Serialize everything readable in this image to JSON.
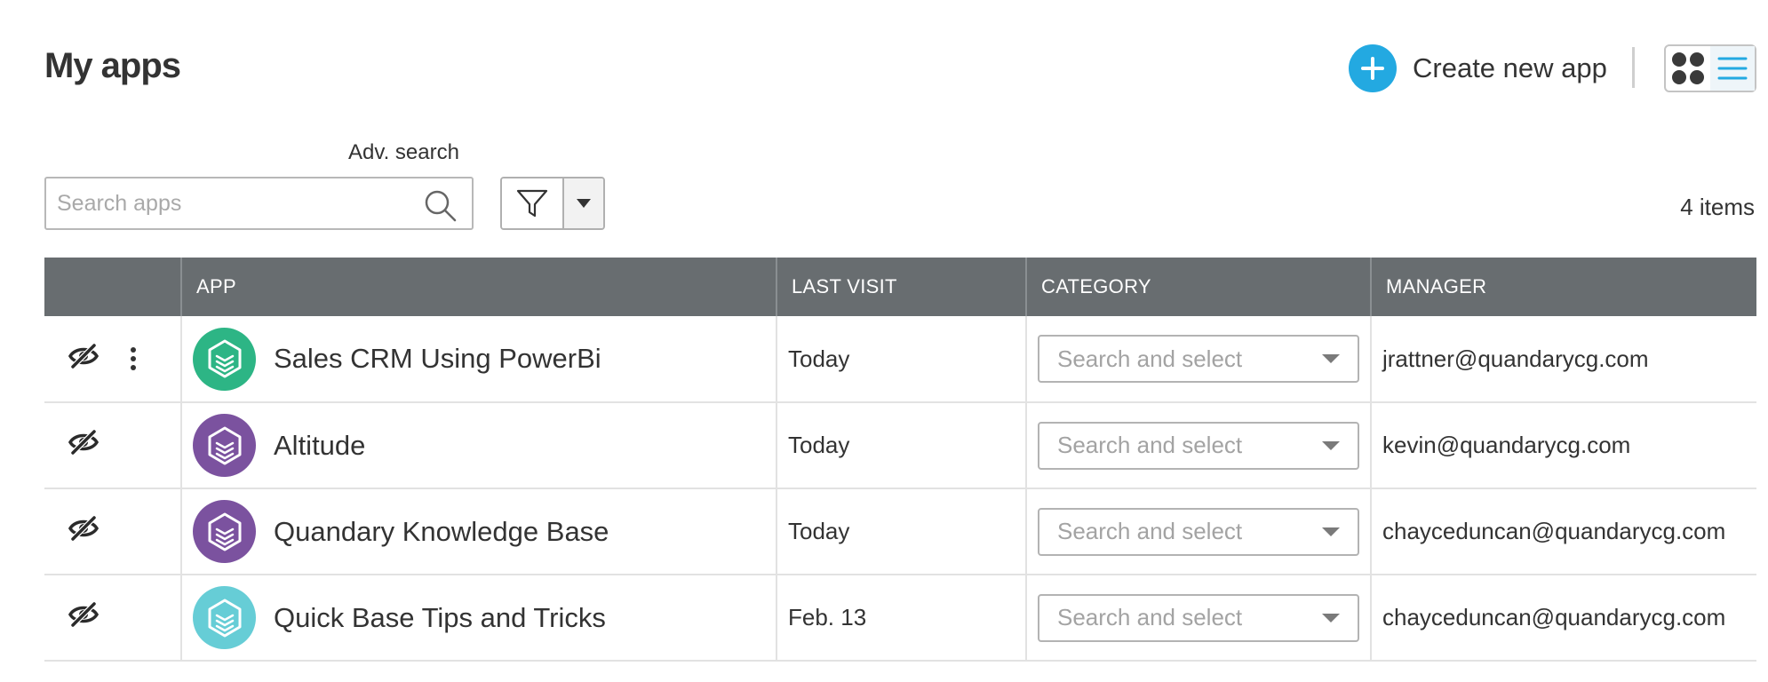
{
  "header": {
    "title": "My apps",
    "create_label": "Create new app",
    "colors": {
      "accent": "#23a9e1",
      "header_bg": "#686d70"
    }
  },
  "view_toggle": {
    "selected": "list",
    "options": [
      "grid",
      "list"
    ]
  },
  "search": {
    "adv_label": "Adv. search",
    "placeholder": "Search apps",
    "value": ""
  },
  "items_count": "4 items",
  "table": {
    "columns": [
      "",
      "APP",
      "LAST VISIT",
      "CATEGORY",
      "MANAGER"
    ],
    "rows": [
      {
        "name": "Sales CRM Using PowerBi",
        "last_visit": "Today",
        "category_placeholder": "Search and select",
        "manager": "jrattner@quandarycg.com",
        "icon_color": "#2db585",
        "has_menu": true
      },
      {
        "name": "Altitude",
        "last_visit": "Today",
        "category_placeholder": "Search and select",
        "manager": "kevin@quandarycg.com",
        "icon_color": "#7b529f",
        "has_menu": false
      },
      {
        "name": "Quandary Knowledge Base",
        "last_visit": "Today",
        "category_placeholder": "Search and select",
        "manager": "chayceduncan@quandarycg.com",
        "icon_color": "#7b529f",
        "has_menu": false
      },
      {
        "name": "Quick Base Tips and Tricks",
        "last_visit": "Feb. 13",
        "category_placeholder": "Search and select",
        "manager": "chayceduncan@quandarycg.com",
        "icon_color": "#66cdd6",
        "has_menu": false
      }
    ]
  }
}
